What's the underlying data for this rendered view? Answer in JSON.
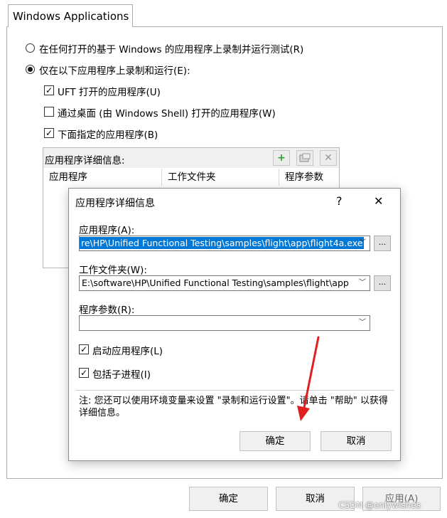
{
  "tab": {
    "label": "Windows Applications"
  },
  "options": {
    "any_app": "在任何打开的基于 Windows 的应用程序上录制并运行测试(R)",
    "only_these": "仅在以下应用程序上录制和运行(E):",
    "uft_opened": "UFT 打开的应用程序(U)",
    "desktop_opened": "通过桌面 (由 Windows Shell) 打开的应用程序(W)",
    "specified": "下面指定的应用程序(B)"
  },
  "details_group": {
    "title": "应用程序详细信息:",
    "columns": [
      "应用程序",
      "工作文件夹",
      "程序参数"
    ]
  },
  "dialog": {
    "title": "应用程序详细信息",
    "help_glyph": "?",
    "close_glyph": "✕",
    "app_label": "应用程序(A):",
    "app_value": "re\\HP\\Unified Functional Testing\\samples\\flight\\app\\flight4a.exe",
    "workdir_label": "工作文件夹(W):",
    "workdir_value": "E:\\software\\HP\\Unified Functional Testing\\samples\\flight\\app",
    "args_label": "程序参数(R):",
    "args_value": "",
    "browse_label": "...",
    "launch_label": "启动应用程序(L)",
    "child_label": "包括子进程(I)",
    "note": "注: 您还可以使用环境变量来设置 \"录制和运行设置\"。请单击 \"帮助\" 以获得详细信息。",
    "ok": "确定",
    "cancel": "取消"
  },
  "footer": {
    "ok": "确定",
    "cancel": "取消",
    "apply": "应用(A)"
  },
  "watermark": "CSDN @onlywishes",
  "colors": {
    "selection": "#0078d7",
    "arrow": "#e02020"
  }
}
